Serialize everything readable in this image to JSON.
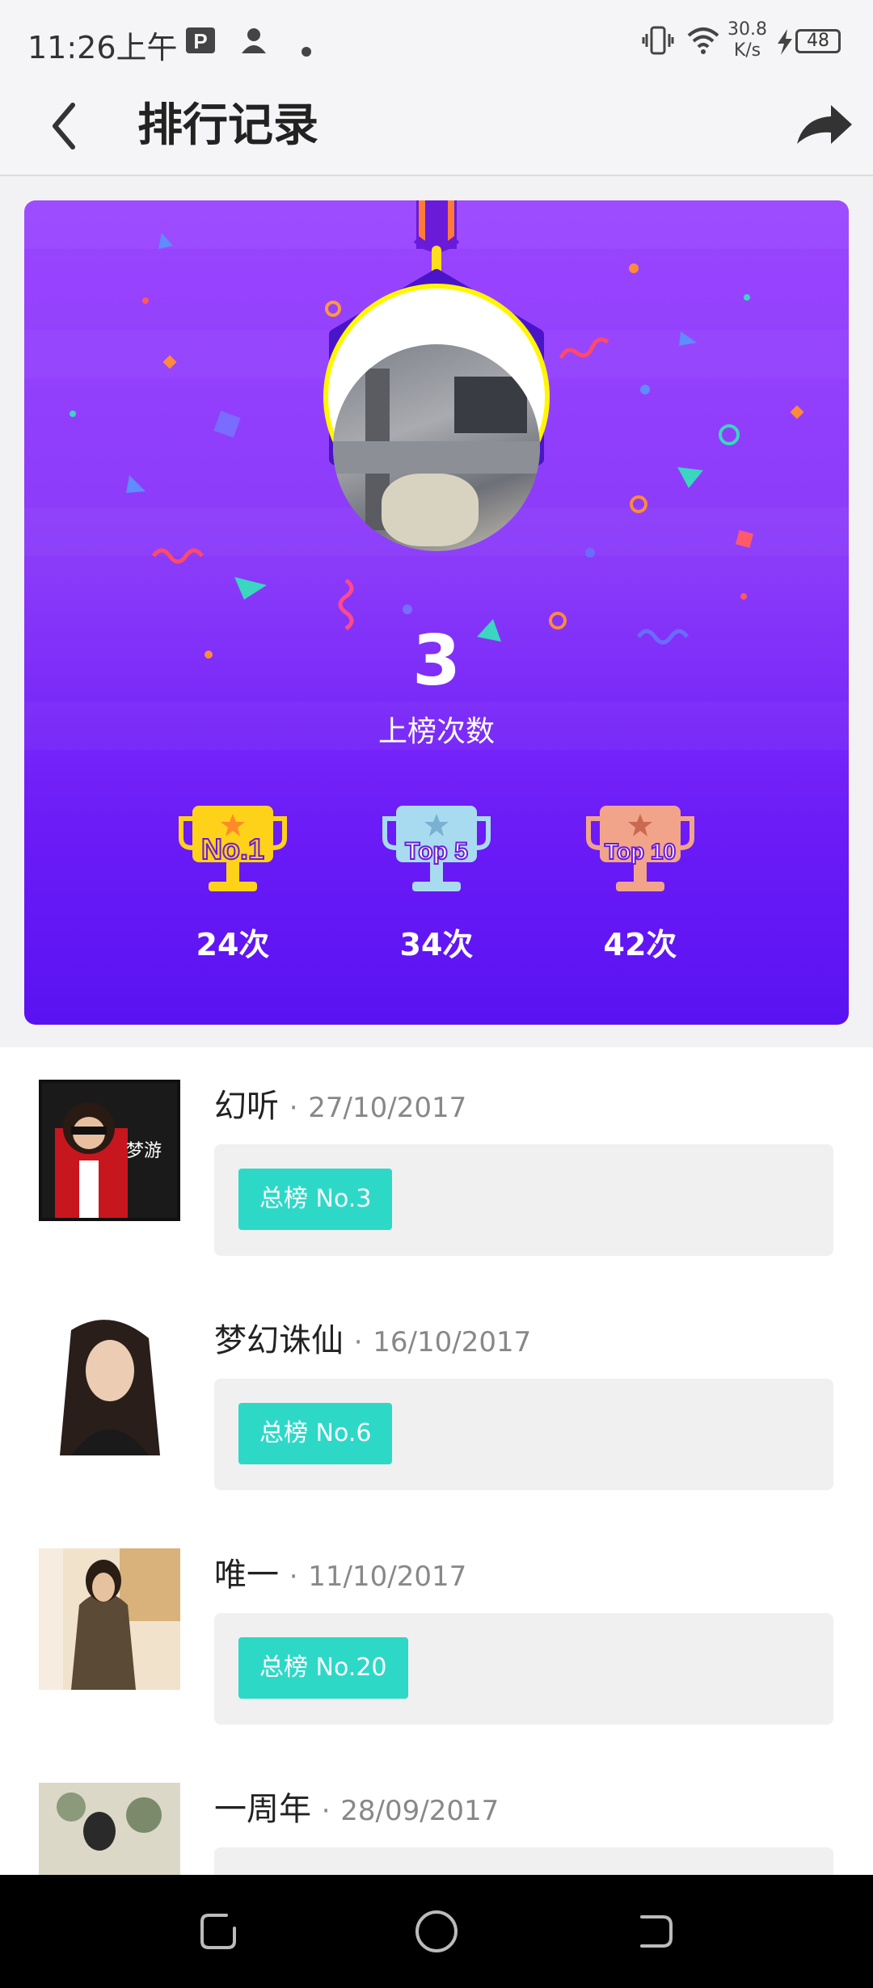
{
  "status_bar": {
    "time": "11:26上午",
    "net_speed_value": "30.8",
    "net_speed_unit": "K/s",
    "battery": "48"
  },
  "header": {
    "title": "排行记录"
  },
  "summary": {
    "count": "3",
    "count_label": "上榜次数",
    "trophies": [
      {
        "label": "No.1",
        "count": "24次",
        "color": "#ffd21a"
      },
      {
        "label": "Top 5",
        "count": "34次",
        "color": "#a9dbf0"
      },
      {
        "label": "Top 10",
        "count": "42次",
        "color": "#f2a48a"
      }
    ]
  },
  "records": [
    {
      "title": "幻听",
      "date": "27/10/2017",
      "rank": "总榜 No.3"
    },
    {
      "title": "梦幻诛仙",
      "date": "16/10/2017",
      "rank": "总榜 No.6"
    },
    {
      "title": "唯一",
      "date": "11/10/2017",
      "rank": "总榜 No.20"
    },
    {
      "title": "一周年",
      "date": "28/09/2017",
      "rank": ""
    }
  ],
  "colors": {
    "accent": "#2ed8c7",
    "card_top": "#9a45ff",
    "card_bottom": "#5a12f2"
  }
}
